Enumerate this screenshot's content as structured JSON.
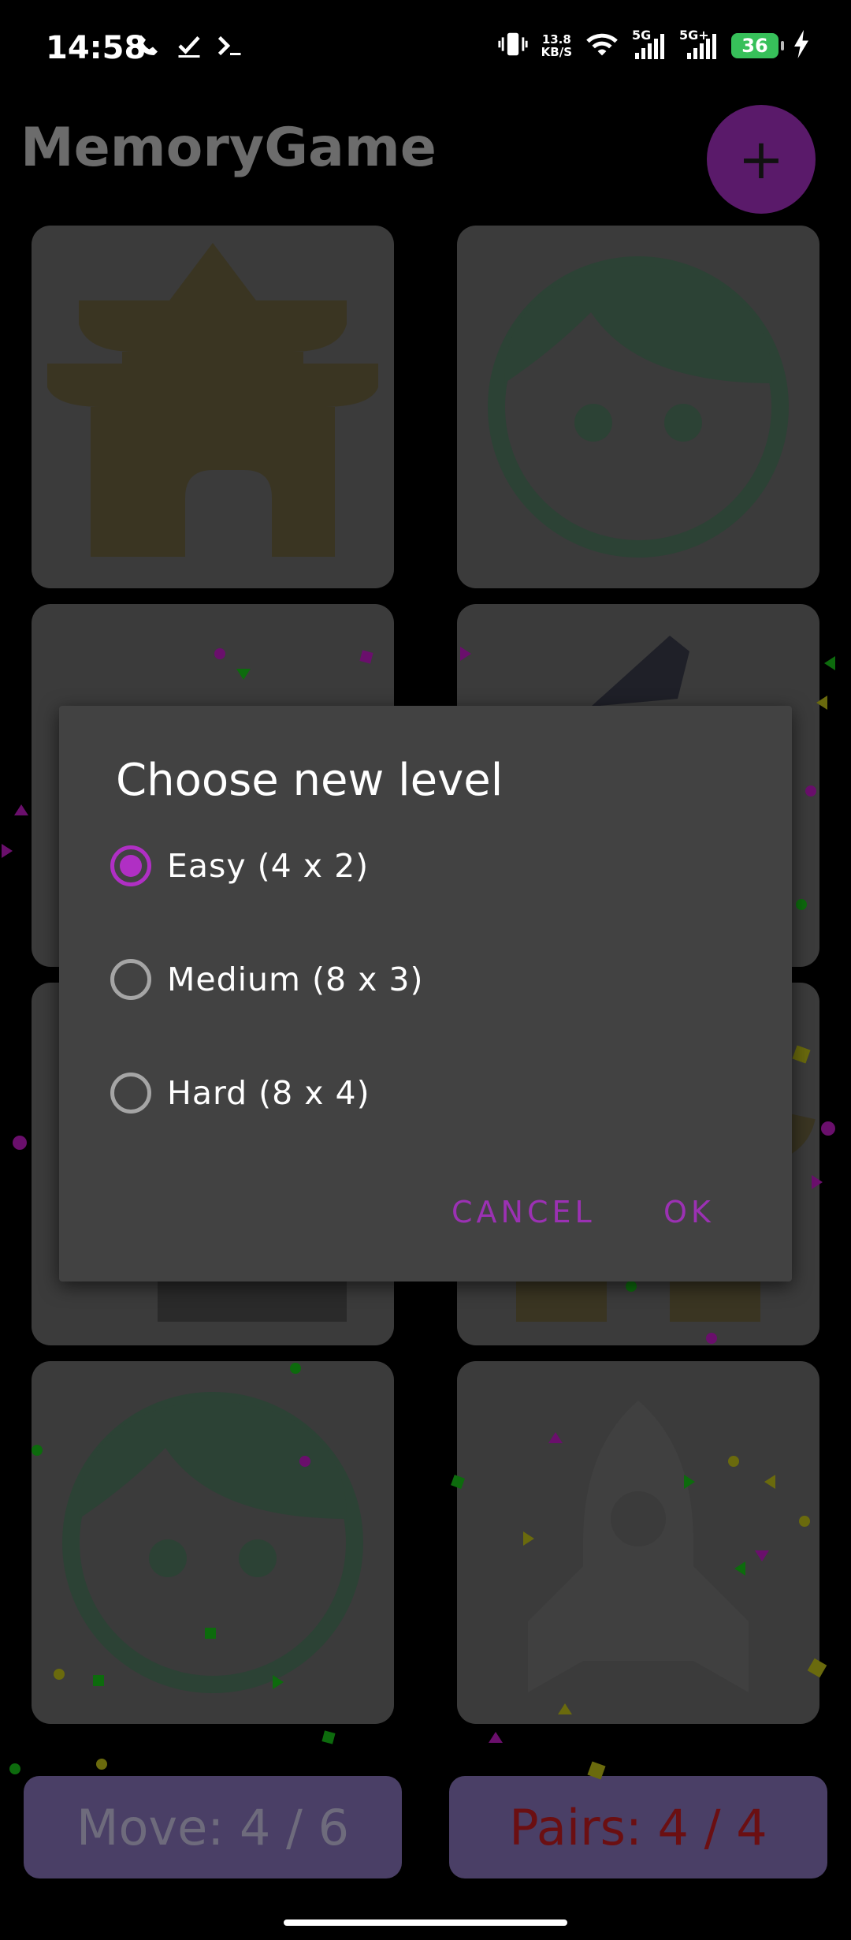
{
  "status_bar": {
    "time": "14:58",
    "left_icons": [
      "call-icon",
      "check-icon",
      "terminal-icon"
    ],
    "network_speed_value": "13.8",
    "network_speed_unit": "KB/S",
    "signal_1": "5G",
    "signal_2": "5G+",
    "battery": "36"
  },
  "app": {
    "title": "MemoryGame",
    "fab_label": "+",
    "cards": [
      "temple-icon",
      "face-icon",
      "face-icon",
      "rocket-icon"
    ],
    "moves": "Move: 4 / 6",
    "pairs": "Pairs: 4 / 4"
  },
  "dialog": {
    "title": "Choose new level",
    "options": [
      {
        "label": "Easy (4 x 2)",
        "selected": true
      },
      {
        "label": "Medium (8 x 3)",
        "selected": false
      },
      {
        "label": "Hard (8 x 4)",
        "selected": false
      }
    ],
    "cancel": "CANCEL",
    "ok": "OK"
  },
  "colors": {
    "accent": "#b02fc4",
    "dialog_bg": "#424242",
    "pairs_text": "#6b0f12"
  }
}
